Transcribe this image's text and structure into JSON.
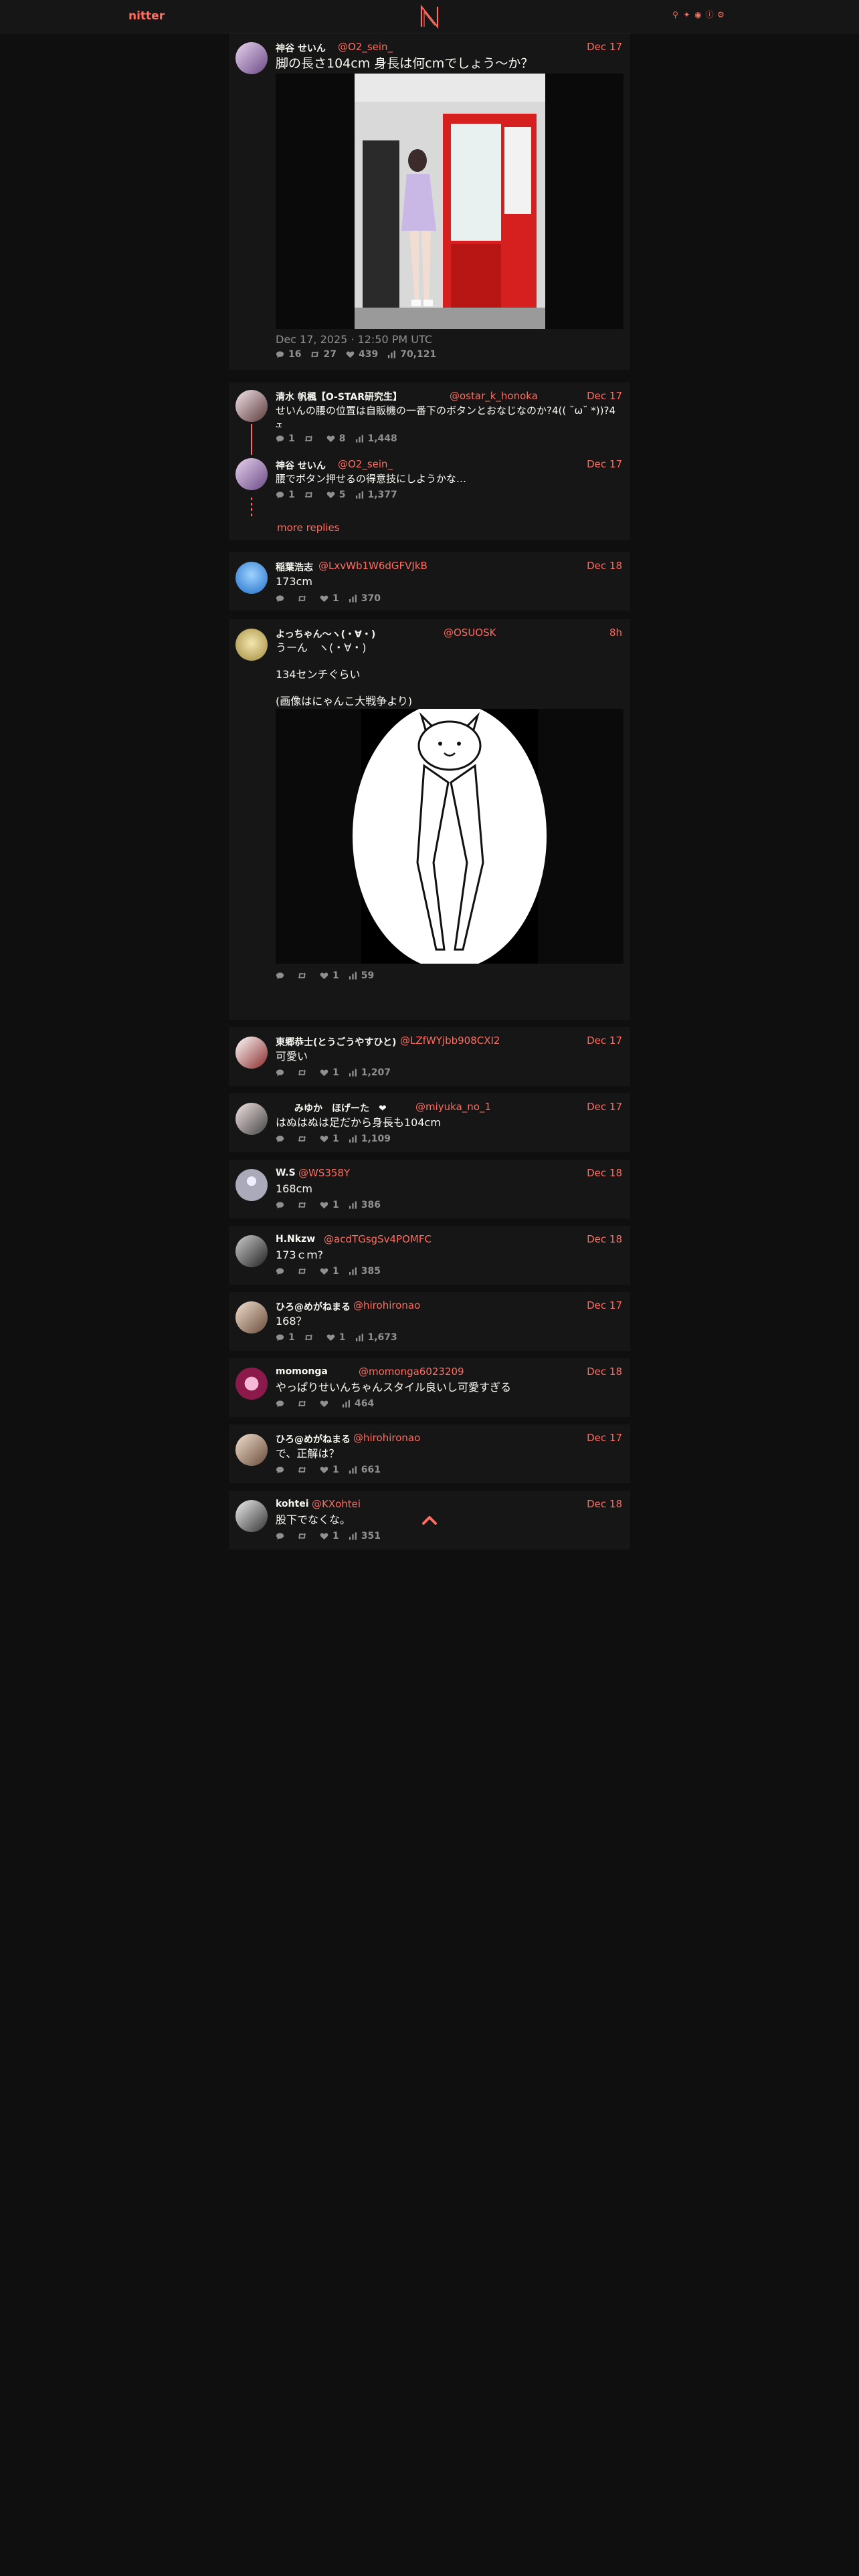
{
  "nav": {
    "brand": "nitter",
    "icons": [
      "search-icon",
      "twitter-icon",
      "rss-icon",
      "info-icon",
      "settings-icon"
    ]
  },
  "main_tweet": {
    "fullname": "神谷 せいん",
    "username": "@O2_sein_",
    "date": "Dec 17",
    "text": "脚の長さ104cm 身長は何cmでしょう〜か？",
    "published": "Dec 17, 2025 · 12:50 PM UTC",
    "stats": {
      "replies": "16",
      "retweets": "27",
      "likes": "439",
      "views": "70,121"
    }
  },
  "reply_thread": [
    {
      "fullname": "清水 帆楓【O-STAR研究生】",
      "username": "@ostar_k_honoka",
      "date": "Dec 17",
      "text": "せいんの腰の位置は自販機の一番下のボタンとおなじなのか?4(( ˘ω˘ *))?4 ܫ",
      "stats": {
        "replies": "1",
        "retweets": "",
        "likes": "8",
        "views": "1,448"
      }
    },
    {
      "fullname": "神谷 せいん",
      "username": "@O2_sein_",
      "date": "Dec 17",
      "text": "腰でボタン押せるの得意技にしようかな…",
      "stats": {
        "replies": "1",
        "retweets": "",
        "likes": "5",
        "views": "1,377"
      }
    }
  ],
  "more_replies": "more replies",
  "replies": [
    {
      "fullname": "稲葉浩志",
      "username": "@LxvWb1W6dGFVJkB",
      "date": "Dec 18",
      "text": "173cm",
      "stats": {
        "replies": "",
        "retweets": "",
        "likes": "1",
        "views": "370"
      }
    },
    {
      "fullname": "よっちゃん〜ヽ(・∀・)",
      "username": "@OSUOSK",
      "date": "8h",
      "text": "うーん　ヽ(・∀・)\n\n134センチぐらい\n\n(画像はにゃんこ大戦争より)",
      "stats": {
        "replies": "",
        "retweets": "",
        "likes": "1",
        "views": "59"
      }
    },
    {
      "fullname": "東郷恭士(とうごうやすひと)",
      "username": "@LZfWYjbb908CXI2",
      "date": "Dec 17",
      "text": "可愛い",
      "stats": {
        "replies": "",
        "retweets": "",
        "likes": "1",
        "views": "1,207"
      }
    },
    {
      "fullname": "みゆか　ほげーた　❤︎",
      "username": "@miyuka_no_1",
      "date": "Dec 17",
      "text": "はぬはぬは足だから身長も104cm",
      "stats": {
        "replies": "",
        "retweets": "",
        "likes": "1",
        "views": "1,109"
      }
    },
    {
      "fullname": "W.S",
      "username": "@WS358Y",
      "date": "Dec 18",
      "text": "168cm",
      "stats": {
        "replies": "",
        "retweets": "",
        "likes": "1",
        "views": "386"
      }
    },
    {
      "fullname": "H.Nkzw",
      "username": "@acdTGsgSv4POMFC",
      "date": "Dec 18",
      "text": "173ｃｍ?",
      "stats": {
        "replies": "",
        "retweets": "",
        "likes": "1",
        "views": "385"
      }
    },
    {
      "fullname": "ひろ@めがねまる",
      "username": "@hirohironao",
      "date": "Dec 17",
      "text": "168？",
      "stats": {
        "replies": "1",
        "retweets": "",
        "likes": "1",
        "views": "1,673"
      }
    },
    {
      "fullname": "momonga",
      "username": "@momonga6023209",
      "date": "Dec 18",
      "text": "やっぱりせいんちゃんスタイル良いし可愛すぎる",
      "stats": {
        "replies": "",
        "retweets": "",
        "likes": "",
        "views": "464"
      }
    },
    {
      "fullname": "ひろ@めがねまる",
      "username": "@hirohironao",
      "date": "Dec 17",
      "text": "で、正解は？",
      "stats": {
        "replies": "",
        "retweets": "",
        "likes": "1",
        "views": "661"
      }
    },
    {
      "fullname": "kohtei",
      "username": "@KXohtei",
      "date": "Dec 18",
      "text": "股下でなくな。",
      "stats": {
        "replies": "",
        "retweets": "",
        "likes": "1",
        "views": "351"
      }
    }
  ],
  "colors": {
    "accent": "#ff6c60",
    "bg": "#0f0f0f",
    "card": "#161616",
    "muted": "#909090"
  }
}
